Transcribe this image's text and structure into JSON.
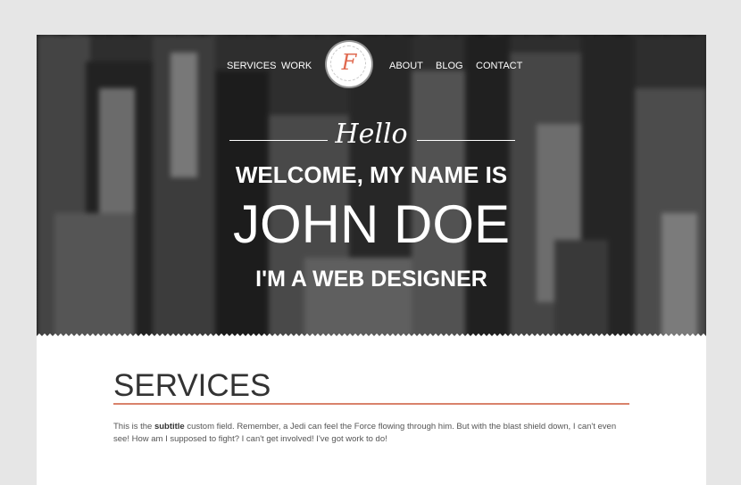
{
  "nav": {
    "links": [
      "SERVICES",
      "WORK",
      "ABOUT",
      "BLOG",
      "CONTACT"
    ],
    "logo_letter": "F"
  },
  "hero": {
    "greeting": "Hello",
    "welcome": "WELCOME, MY NAME IS",
    "name": "JOHN DOE",
    "role": "I'M A WEB DESIGNER"
  },
  "services": {
    "title": "SERVICES",
    "text_before": "This is the ",
    "text_bold": "subtitle",
    "text_after": " custom field. Remember, a Jedi can feel the Force flowing through him. But with the blast shield down, I can't even see! How am I supposed to fight? I can't get involved! I've got work to do!"
  },
  "colors": {
    "accent": "#d9826b",
    "logo": "#e06a50",
    "background": "#e6e6e6"
  }
}
